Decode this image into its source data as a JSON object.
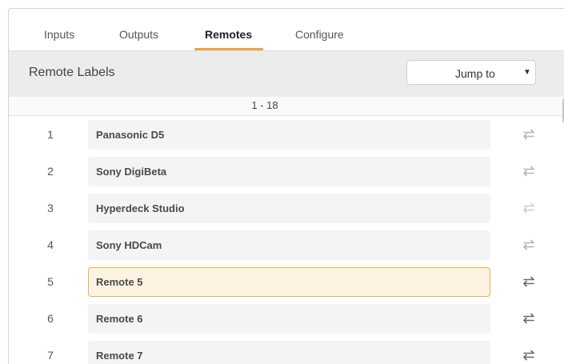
{
  "tabs": [
    {
      "label": "Inputs"
    },
    {
      "label": "Outputs"
    },
    {
      "label": "Remotes",
      "active": true
    },
    {
      "label": "Configure"
    }
  ],
  "header": {
    "title": "Remote Labels",
    "jump_label": "Jump to",
    "jump_caret": "▼"
  },
  "range_label": "1 - 18",
  "rows": [
    {
      "number": "1",
      "label": "Panasonic D5",
      "icon": "swap-icon",
      "icon_shade": "light"
    },
    {
      "number": "2",
      "label": "Sony DigiBeta",
      "icon": "swap-icon",
      "icon_shade": "light"
    },
    {
      "number": "3",
      "label": "Hyperdeck Studio",
      "icon": "swap-icon",
      "icon_shade": "lighter"
    },
    {
      "number": "4",
      "label": "Sony HDCam",
      "icon": "swap-icon",
      "icon_shade": "light"
    },
    {
      "number": "5",
      "label": "Remote 5",
      "selected": true,
      "icon": "swap-icon",
      "icon_shade": "dark"
    },
    {
      "number": "6",
      "label": "Remote 6",
      "icon": "swap-icon",
      "icon_shade": "dark"
    },
    {
      "number": "7",
      "label": "Remote 7",
      "icon": "swap-icon",
      "icon_shade": "dark"
    }
  ],
  "colors": {
    "accent": "#f0a33a",
    "selected_border": "#e7b347",
    "selected_fill": "#fef3e3",
    "header_bg": "#ececec",
    "field_bg": "#f4f4f4"
  }
}
